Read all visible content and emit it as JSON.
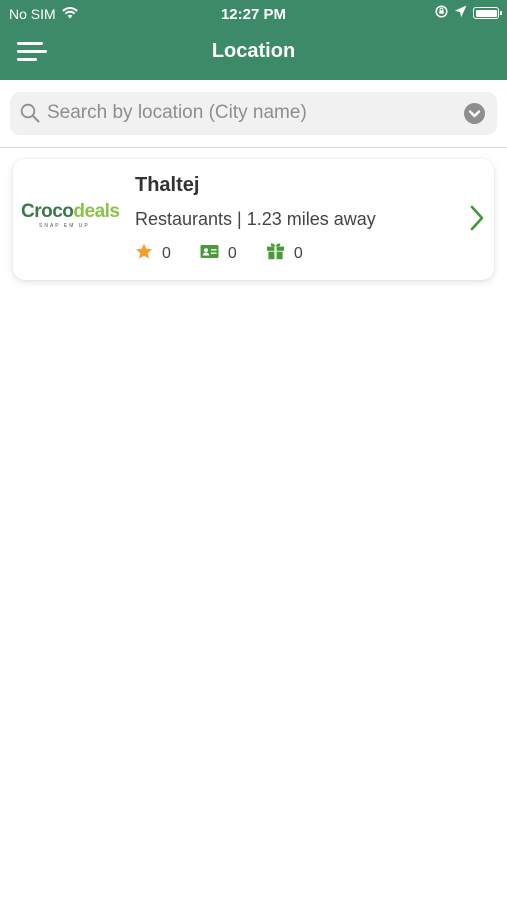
{
  "status_bar": {
    "carrier": "No SIM",
    "time": "12:27 PM"
  },
  "nav": {
    "title": "Location"
  },
  "search": {
    "placeholder": "Search by location (City name)",
    "value": ""
  },
  "locations": [
    {
      "logo_text_a": "Croco",
      "logo_text_b": "deals",
      "logo_tagline": "SNAP EM UP",
      "name": "Thaltej",
      "subtitle": "Restaurants | 1.23 miles away",
      "stats": {
        "favorites": "0",
        "cards": "0",
        "rewards": "0"
      }
    }
  ],
  "colors": {
    "primary": "#3d8a69",
    "star": "#f0a030",
    "accent_green": "#4a9a3a",
    "chevron": "#3c9a3a"
  }
}
